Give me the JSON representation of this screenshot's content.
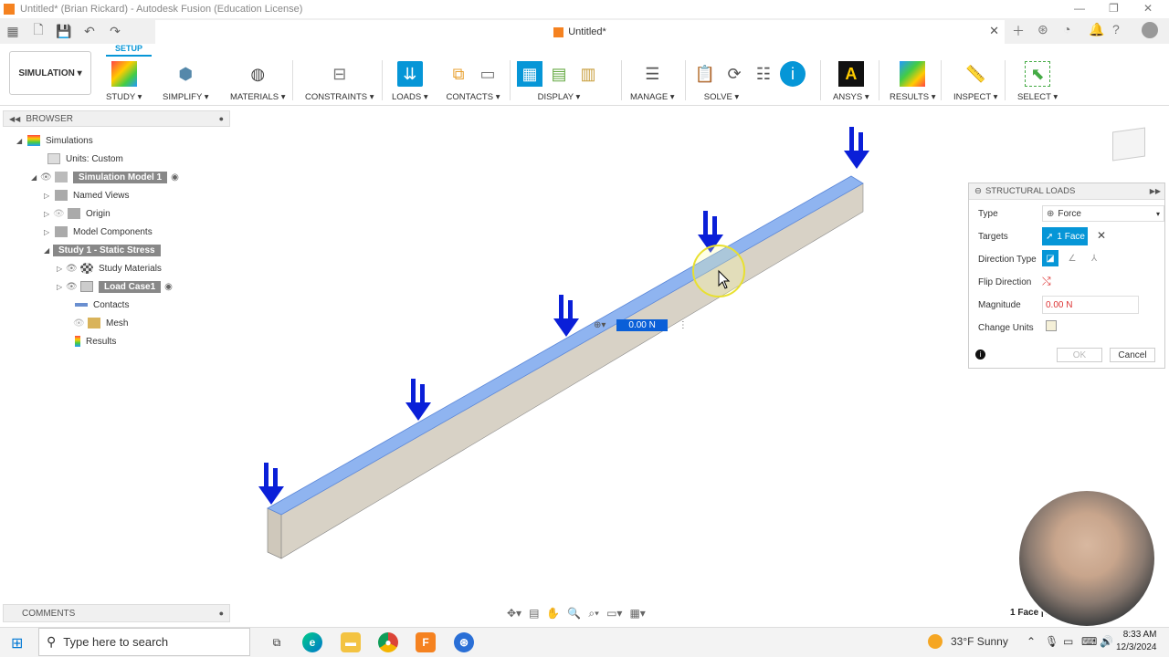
{
  "window": {
    "title": "Untitled* (Brian Rickard) - Autodesk Fusion (Education License)"
  },
  "document_tab": {
    "name": "Untitled*"
  },
  "ribbon": {
    "workspace": "SIMULATION",
    "active_tab": "SETUP",
    "groups": [
      {
        "label": "STUDY ▾"
      },
      {
        "label": "SIMPLIFY ▾"
      },
      {
        "label": "MATERIALS ▾"
      },
      {
        "label": "CONSTRAINTS ▾"
      },
      {
        "label": "LOADS ▾"
      },
      {
        "label": "CONTACTS ▾"
      },
      {
        "label": "DISPLAY ▾"
      },
      {
        "label": "MANAGE ▾"
      },
      {
        "label": "SOLVE ▾"
      },
      {
        "label": "ANSYS ▾"
      },
      {
        "label": "RESULTS ▾"
      },
      {
        "label": "INSPECT ▾"
      },
      {
        "label": "SELECT ▾"
      }
    ]
  },
  "browser": {
    "header": "BROWSER",
    "items": [
      {
        "label": "Simulations"
      },
      {
        "label": "Units: Custom"
      },
      {
        "label": "Simulation Model 1"
      },
      {
        "label": "Named Views"
      },
      {
        "label": "Origin"
      },
      {
        "label": "Model Components"
      },
      {
        "label": "Study 1 - Static Stress"
      },
      {
        "label": "Study Materials"
      },
      {
        "label": "Load Case1"
      },
      {
        "label": "Contacts"
      },
      {
        "label": "Mesh"
      },
      {
        "label": "Results"
      }
    ]
  },
  "viewport": {
    "inline_value": "0.00 N"
  },
  "structural_loads": {
    "title": "STRUCTURAL LOADS",
    "type_label": "Type",
    "type_value": "Force",
    "targets_label": "Targets",
    "targets_value": "1 Face",
    "direction_type_label": "Direction Type",
    "flip_direction_label": "Flip Direction",
    "magnitude_label": "Magnitude",
    "magnitude_value": "0.00 N",
    "change_units_label": "Change Units",
    "ok_label": "OK",
    "cancel_label": "Cancel"
  },
  "comments": {
    "label": "COMMENTS"
  },
  "status": {
    "selection": "1 Face | A"
  },
  "taskbar": {
    "search_placeholder": "Type here to search",
    "weather": "33°F  Sunny",
    "time": "8:33 AM",
    "date": "12/3/2024"
  },
  "colors": {
    "accent": "#0696d7",
    "load_arrow": "#0a1fd8",
    "beam_face": "#d8d2c6",
    "selected_face": "#8fb4f0"
  }
}
